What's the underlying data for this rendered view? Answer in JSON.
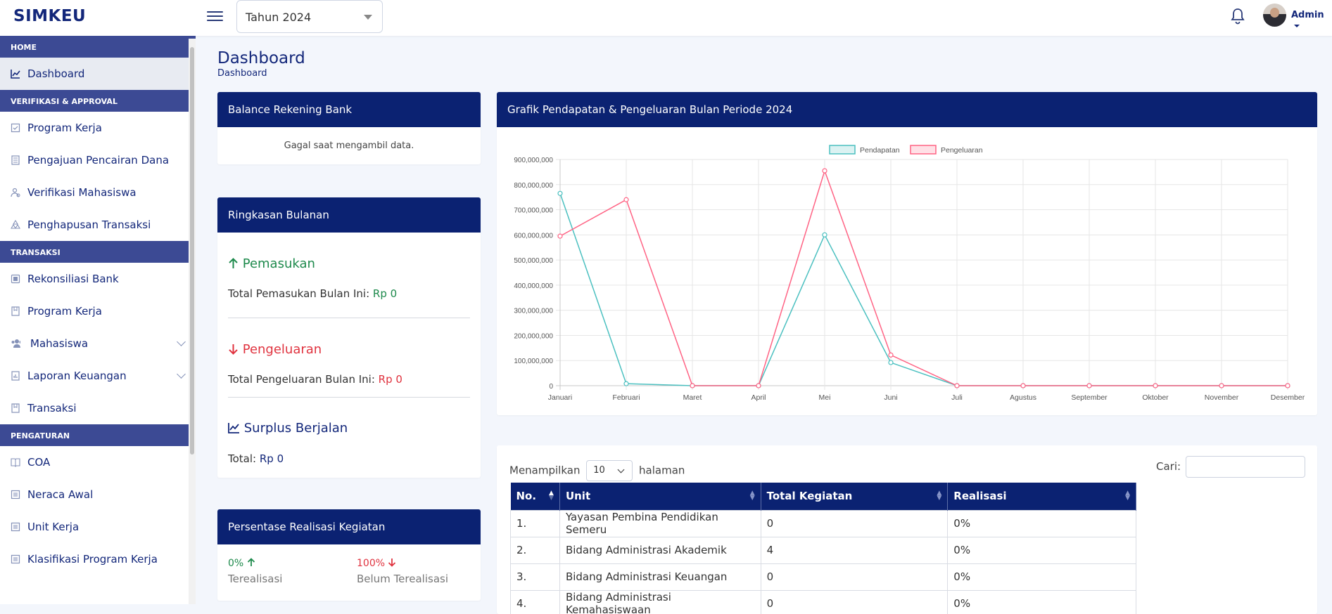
{
  "header": {
    "brand": "SIMKEU",
    "year_select": "Tahun 2024",
    "user": "Admin"
  },
  "sidebar": {
    "sections": [
      {
        "label": "HOME",
        "items": [
          {
            "label": "Dashboard",
            "icon": "chart-line-icon",
            "active": true
          }
        ]
      },
      {
        "label": "VERIFIKASI & APPROVAL",
        "items": [
          {
            "label": "Program Kerja",
            "icon": "checklist-icon"
          },
          {
            "label": "Pengajuan Pencairan Dana",
            "icon": "document-icon"
          },
          {
            "label": "Verifikasi Mahasiswa",
            "icon": "user-check-icon"
          },
          {
            "label": "Penghapusan Transaksi",
            "icon": "recycle-icon"
          }
        ]
      },
      {
        "label": "TRANSAKSI",
        "items": [
          {
            "label": "Rekonsiliasi Bank",
            "icon": "bank-icon"
          },
          {
            "label": "Program Kerja",
            "icon": "bookmark-icon"
          },
          {
            "label": "Mahasiswa",
            "icon": "users-icon",
            "expandable": true
          },
          {
            "label": "Laporan Keuangan",
            "icon": "report-icon",
            "expandable": true
          },
          {
            "label": "Transaksi",
            "icon": "bookmark-icon"
          }
        ]
      },
      {
        "label": "PENGATURAN",
        "items": [
          {
            "label": "COA",
            "icon": "book-icon"
          },
          {
            "label": "Neraca Awal",
            "icon": "grid-icon"
          },
          {
            "label": "Unit Kerja",
            "icon": "grid-icon"
          },
          {
            "label": "Klasifikasi Program Kerja",
            "icon": "grid-icon"
          }
        ]
      }
    ]
  },
  "page": {
    "title": "Dashboard",
    "breadcrumb": "Dashboard"
  },
  "balance": {
    "title": "Balance Rekening Bank",
    "message": "Gagal saat mengambil data."
  },
  "ringkasan": {
    "title": "Ringkasan Bulanan",
    "pemasukan_label": "Pemasukan",
    "pemasukan_text": "Total Pemasukan Bulan Ini:",
    "pemasukan_value": "Rp 0",
    "pengeluaran_label": "Pengeluaran",
    "pengeluaran_text": "Total Pengeluaran Bulan Ini:",
    "pengeluaran_value": "Rp 0",
    "surplus_label": "Surplus Berjalan",
    "surplus_text": "Total:",
    "surplus_value": "Rp 0",
    "colors": {
      "income": "#1e8a4c",
      "expense": "#e0333f",
      "surplus": "#13277a"
    }
  },
  "realisasi": {
    "title": "Persentase Realisasi Kegiatan",
    "done_value": "0%",
    "done_label": "Terealisasi",
    "notdone_value": "100%",
    "notdone_label": "Belum Terealisasi"
  },
  "chart_panel": {
    "title": "Grafik Pendapatan & Pengeluaran Bulan Periode 2024"
  },
  "chart_data": {
    "type": "line",
    "categories": [
      "Januari",
      "Februari",
      "Maret",
      "April",
      "Mei",
      "Juni",
      "Juli",
      "Agustus",
      "September",
      "Oktober",
      "November",
      "Desember"
    ],
    "series": [
      {
        "name": "Pendapatan",
        "color": "#4bc0c0",
        "values": [
          765000000,
          8000000,
          0,
          0,
          600000000,
          92000000,
          0,
          0,
          0,
          0,
          0,
          0
        ]
      },
      {
        "name": "Pengeluaran",
        "color": "#ff6384",
        "values": [
          595000000,
          740000000,
          0,
          0,
          855000000,
          122000000,
          0,
          0,
          0,
          0,
          0,
          0
        ]
      }
    ],
    "yticks": [
      "0",
      "100,000,000",
      "200,000,000",
      "300,000,000",
      "400,000,000",
      "500,000,000",
      "600,000,000",
      "700,000,000",
      "800,000,000",
      "900,000,000"
    ],
    "ylim": [
      0,
      900000000
    ],
    "grid": true,
    "legend": "top"
  },
  "table": {
    "show_label": "Menampilkan",
    "page_size": "10",
    "page_suffix": "halaman",
    "search_label": "Cari:",
    "search_value": "",
    "columns": [
      "No.",
      "Unit",
      "Total Kegiatan",
      "Realisasi"
    ],
    "rows": [
      [
        "1.",
        "Yayasan Pembina Pendidikan Semeru",
        "0",
        "0%"
      ],
      [
        "2.",
        "Bidang Administrasi Akademik",
        "4",
        "0%"
      ],
      [
        "3.",
        "Bidang Administrasi Keuangan",
        "0",
        "0%"
      ],
      [
        "4.",
        "Bidang Administrasi Kemahasiswaan",
        "0",
        "0%"
      ]
    ]
  }
}
